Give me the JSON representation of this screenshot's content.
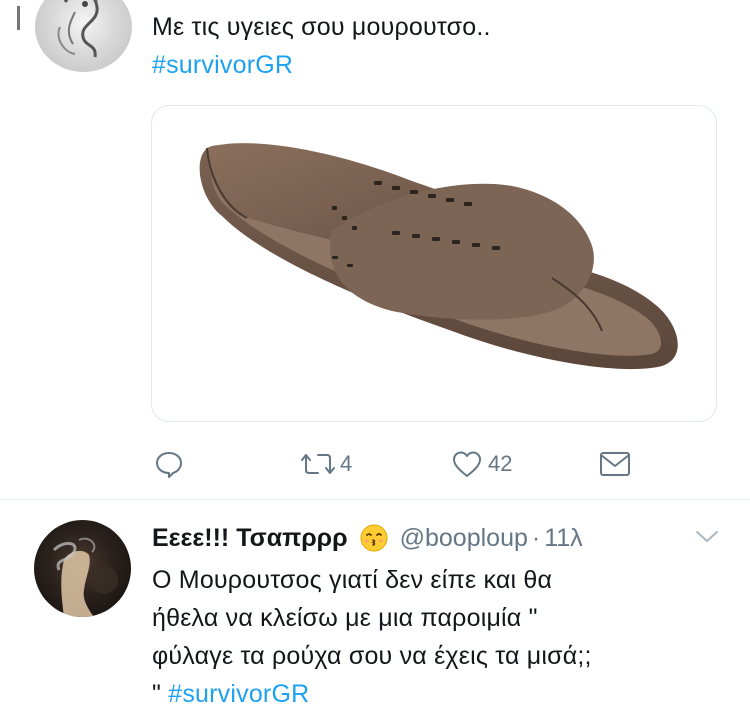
{
  "tweet1": {
    "text_line1": "Με τις υγειες σου μουρουτσο..",
    "hashtag": "#survivorGR",
    "media": {
      "description_icon": "sandal-photo"
    },
    "actions": {
      "reply_icon": "reply-icon",
      "retweet_icon": "retweet-icon",
      "retweet_count": "4",
      "like_icon": "heart-icon",
      "like_count": "42",
      "dm_icon": "envelope-icon"
    }
  },
  "tweet2": {
    "display_name": "Εεεε!!! Τσαπρρρ",
    "emoji": "kissing-face-emoji",
    "handle": "@booploup",
    "separator": "·",
    "time": "11λ",
    "menu_icon": "chevron-down-icon",
    "text_lines": [
      "Ο Μουρουτσος γιατί δεν είπε και θα",
      "ήθελα να κλείσω με μια παροιμία \"",
      "φύλαγε τα ρούχα σου να έχεις τα μισά;;"
    ],
    "last_line_prefix": "\" ",
    "hashtag": "#survivorGR"
  },
  "colors": {
    "accent": "#1da1f2",
    "text": "#14171a",
    "secondary": "#657786",
    "border": "#e1e8ed"
  }
}
